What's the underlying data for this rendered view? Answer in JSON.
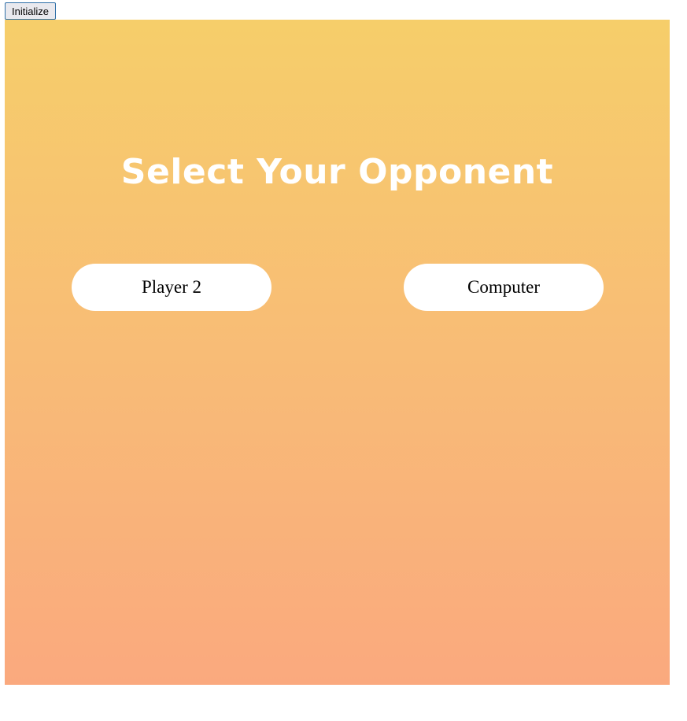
{
  "toolbar": {
    "initialize_label": "Initialize"
  },
  "screen": {
    "title": "Select Your Opponent",
    "options": [
      {
        "label": "Player 2"
      },
      {
        "label": "Computer"
      }
    ]
  },
  "colors": {
    "gradient_top": "#f6ce6a",
    "gradient_bottom": "#faa97e",
    "title_text": "#ffffff",
    "button_bg": "#ffffff"
  }
}
